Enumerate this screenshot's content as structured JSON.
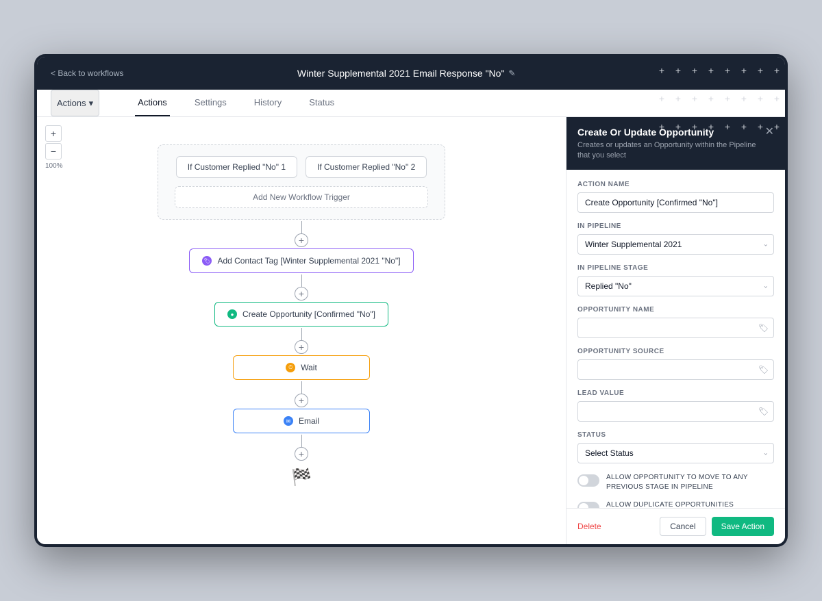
{
  "header": {
    "back_label": "< Back to workflows",
    "title": "Winter Supplemental 2021 Email Response \"No\"",
    "edit_icon": "✎"
  },
  "tabs": {
    "actions_btn": "Actions",
    "items": [
      "Actions",
      "Settings",
      "History",
      "Status"
    ],
    "active": "Actions"
  },
  "zoom": {
    "plus": "+",
    "minus": "−",
    "level": "100%"
  },
  "workflow": {
    "trigger1": "If Customer Replied \"No\" 1",
    "trigger2": "If Customer Replied \"No\" 2",
    "add_trigger": "Add New Workflow Trigger",
    "node_tag": "Add Contact Tag [Winter Supplemental 2021 \"No\"]",
    "node_opportunity": "Create Opportunity [Confirmed \"No\"]",
    "node_wait": "Wait",
    "node_email": "Email"
  },
  "panel": {
    "title": "Create Or Update Opportunity",
    "subtitle": "Creates or updates an Opportunity within the Pipeline that you select",
    "fields": {
      "action_name_label": "ACTION NAME",
      "action_name_value": "Create Opportunity [Confirmed \"No\"]",
      "in_pipeline_label": "IN PIPELINE",
      "in_pipeline_value": "Winter Supplemental 2021",
      "in_pipeline_stage_label": "IN PIPELINE STAGE",
      "in_pipeline_stage_value": "Replied \"No\"",
      "opportunity_name_label": "OPPORTUNITY NAME",
      "opportunity_name_placeholder": "",
      "opportunity_source_label": "OPPORTUNITY SOURCE",
      "opportunity_source_placeholder": "",
      "lead_value_label": "LEAD VALUE",
      "lead_value_placeholder": "",
      "status_label": "STATUS",
      "status_placeholder": "Select Status"
    },
    "toggles": {
      "allow_previous": "ALLOW OPPORTUNITY TO MOVE TO ANY PREVIOUS STAGE IN PIPELINE",
      "allow_duplicate": "ALLOW DUPLICATE OPPORTUNITIES"
    },
    "footer": {
      "delete": "Delete",
      "cancel": "Cancel",
      "save": "Save Action"
    }
  }
}
